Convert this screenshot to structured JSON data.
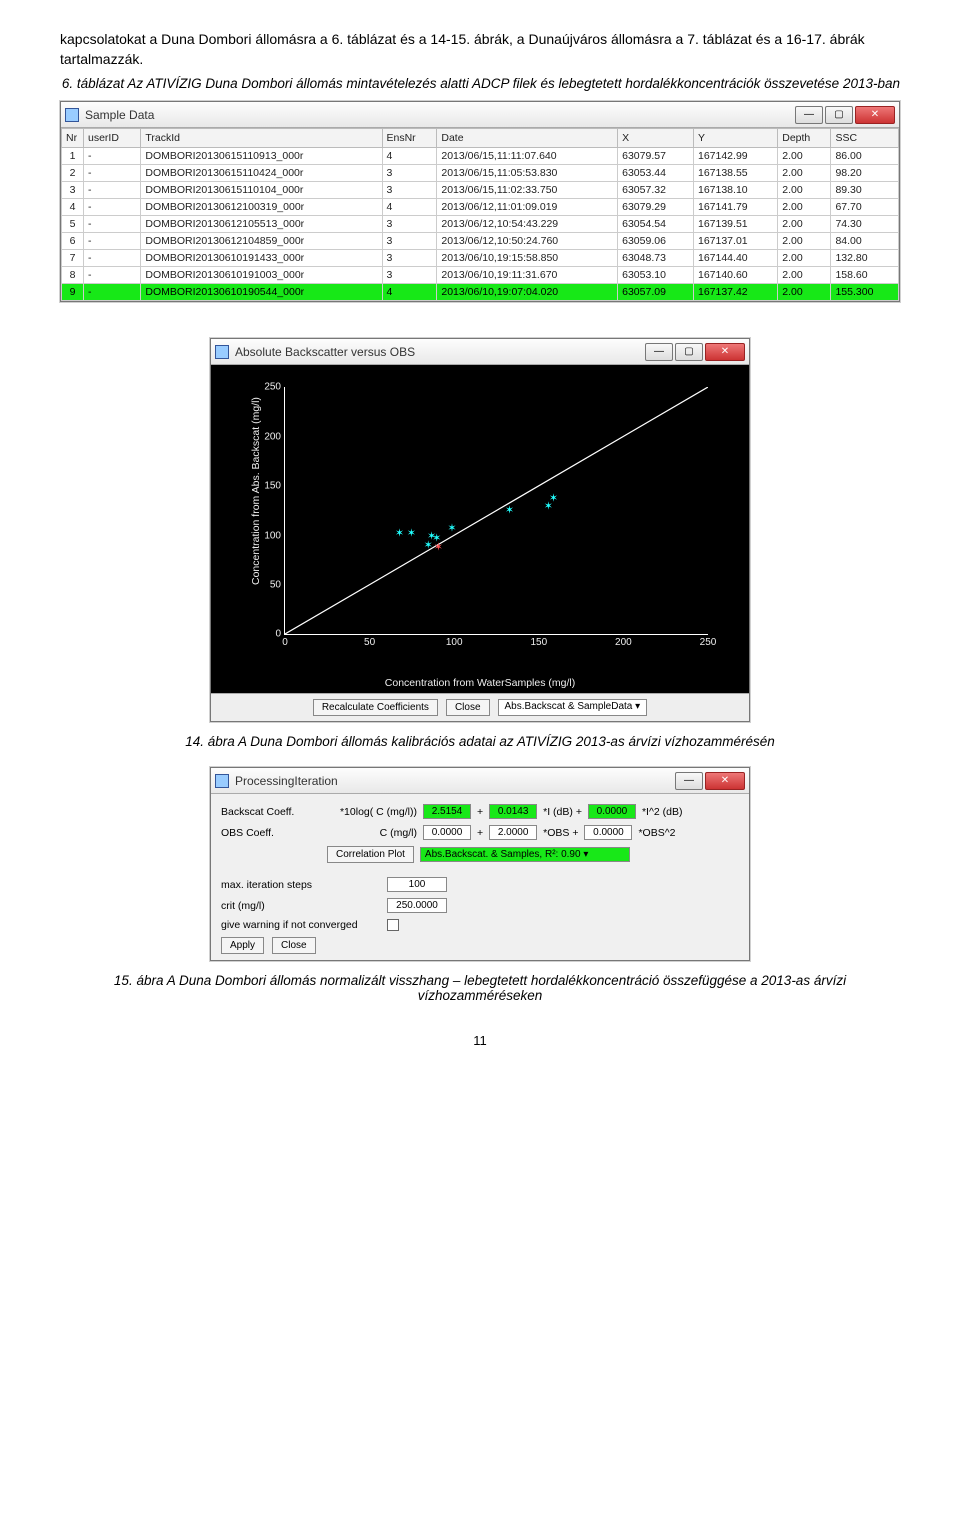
{
  "intro_text": "kapcsolatokat a Duna Dombori állomásra a 6. táblázat és a 14-15. ábrák, a Dunaújváros állomásra a 7. táblázat és a 16-17. ábrák tartalmazzák.",
  "table_caption": "6. táblázat Az ATIVÍZIG Duna Dombori állomás mintavételezés alatti ADCP filek és lebegtetett hordalékkoncentrációk összevetése 2013-ban",
  "sample_window": {
    "title": "Sample Data",
    "cols": [
      "Nr",
      "userID",
      "TrackId",
      "EnsNr",
      "Date",
      "X",
      "Y",
      "Depth",
      "SSC"
    ],
    "rows": [
      [
        "1",
        "-",
        "DOMBORI20130615110913_000r",
        "4",
        "2013/06/15,11:11:07.640",
        "63079.57",
        "167142.99",
        "2.00",
        "86.00"
      ],
      [
        "2",
        "-",
        "DOMBORI20130615110424_000r",
        "3",
        "2013/06/15,11:05:53.830",
        "63053.44",
        "167138.55",
        "2.00",
        "98.20"
      ],
      [
        "3",
        "-",
        "DOMBORI20130615110104_000r",
        "3",
        "2013/06/15,11:02:33.750",
        "63057.32",
        "167138.10",
        "2.00",
        "89.30"
      ],
      [
        "4",
        "-",
        "DOMBORI20130612100319_000r",
        "4",
        "2013/06/12,11:01:09.019",
        "63079.29",
        "167141.79",
        "2.00",
        "67.70"
      ],
      [
        "5",
        "-",
        "DOMBORI20130612105513_000r",
        "3",
        "2013/06/12,10:54:43.229",
        "63054.54",
        "167139.51",
        "2.00",
        "74.30"
      ],
      [
        "6",
        "-",
        "DOMBORI20130612104859_000r",
        "3",
        "2013/06/12,10:50:24.760",
        "63059.06",
        "167137.01",
        "2.00",
        "84.00"
      ],
      [
        "7",
        "-",
        "DOMBORI20130610191433_000r",
        "3",
        "2013/06/10,19:15:58.850",
        "63048.73",
        "167144.40",
        "2.00",
        "132.80"
      ],
      [
        "8",
        "-",
        "DOMBORI20130610191003_000r",
        "3",
        "2013/06/10,19:11:31.670",
        "63053.10",
        "167140.60",
        "2.00",
        "158.60"
      ],
      [
        "9",
        "-",
        "DOMBORI20130610190544_000r",
        "4",
        "2013/06/10,19:07:04.020",
        "63057.09",
        "167137.42",
        "2.00",
        "155.300"
      ]
    ]
  },
  "chart_window": {
    "title": "Absolute Backscatter versus OBS",
    "btn_recalc": "Recalculate Coefficients",
    "btn_close": "Close",
    "sel": "Abs.Backscat & SampleData"
  },
  "chart_data": {
    "type": "scatter",
    "title": "Absolute Backscatter versus OBS",
    "xlabel": "Concentration from WaterSamples (mg/l)",
    "ylabel": "Concentration from Abs. Backscat (mg/l)",
    "xlim": [
      0,
      250
    ],
    "ylim": [
      0,
      250
    ],
    "xticks": [
      0,
      50,
      100,
      150,
      200,
      250
    ],
    "yticks": [
      0,
      50,
      100,
      150,
      200,
      250
    ],
    "series": [
      {
        "name": "samples",
        "color": "#2ff",
        "points": [
          {
            "x": 67,
            "y": 95
          },
          {
            "x": 74,
            "y": 95
          },
          {
            "x": 84,
            "y": 82
          },
          {
            "x": 86,
            "y": 92
          },
          {
            "x": 98,
            "y": 100
          },
          {
            "x": 89,
            "y": 90
          },
          {
            "x": 132,
            "y": 118
          },
          {
            "x": 158,
            "y": 130
          },
          {
            "x": 155,
            "y": 122
          }
        ]
      },
      {
        "name": "outlier",
        "color": "#f55",
        "points": [
          {
            "x": 90,
            "y": 80
          }
        ]
      }
    ],
    "reference_line": {
      "from": [
        0,
        0
      ],
      "to": [
        250,
        250
      ]
    }
  },
  "fig14_caption": "14. ábra A Duna Dombori állomás kalibrációs adatai az ATIVÍZIG 2013-as árvízi vízhozammérésén",
  "proc_window": {
    "title": "ProcessingIteration",
    "row1_lab": "Backscat Coeff.",
    "row1_f": "*10log( C (mg/l))",
    "row1_vals": [
      "2.5154",
      "0.0143",
      "0.0000"
    ],
    "row1_txts": [
      "*I (dB) +",
      "*I^2 (dB)"
    ],
    "row2_lab": "OBS Coeff.",
    "row2_f": "C (mg/l)",
    "row2_vals": [
      "0.0000",
      "2.0000",
      "0.0000"
    ],
    "row2_txts": [
      "*OBS +",
      "*OBS^2"
    ],
    "corr_btn": "Correlation Plot",
    "corr_sel": "Abs.Backscat. & Samples, R²: 0.90",
    "max_iter_lab": "max. iteration steps",
    "max_iter_val": "100",
    "crit_lab": "crit (mg/l)",
    "crit_val": "250.0000",
    "warn_lab": "give warning if not converged",
    "apply": "Apply",
    "close": "Close"
  },
  "fig15_caption": "15. ábra A Duna Dombori állomás normalizált visszhang – lebegtetett hordalékkoncentráció összefüggése a 2013-as árvízi vízhozamméréseken",
  "page_num": "11"
}
